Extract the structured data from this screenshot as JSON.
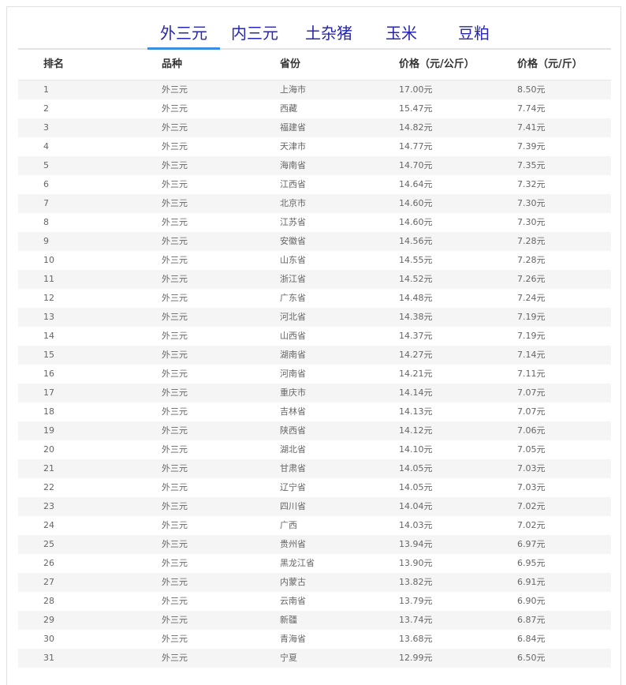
{
  "tabs": [
    {
      "label": "外三元",
      "active": true
    },
    {
      "label": "内三元",
      "active": false
    },
    {
      "label": "土杂猪",
      "active": false
    },
    {
      "label": "玉米",
      "active": false
    },
    {
      "label": "豆粕",
      "active": false
    }
  ],
  "table": {
    "headers": [
      "排名",
      "品种",
      "省份",
      "价格（元/公斤）",
      "价格（元/斤）"
    ],
    "rows": [
      [
        "1",
        "外三元",
        "上海市",
        "17.00元",
        "8.50元"
      ],
      [
        "2",
        "外三元",
        "西藏",
        "15.47元",
        "7.74元"
      ],
      [
        "3",
        "外三元",
        "福建省",
        "14.82元",
        "7.41元"
      ],
      [
        "4",
        "外三元",
        "天津市",
        "14.77元",
        "7.39元"
      ],
      [
        "5",
        "外三元",
        "海南省",
        "14.70元",
        "7.35元"
      ],
      [
        "6",
        "外三元",
        "江西省",
        "14.64元",
        "7.32元"
      ],
      [
        "7",
        "外三元",
        "北京市",
        "14.60元",
        "7.30元"
      ],
      [
        "8",
        "外三元",
        "江苏省",
        "14.60元",
        "7.30元"
      ],
      [
        "9",
        "外三元",
        "安徽省",
        "14.56元",
        "7.28元"
      ],
      [
        "10",
        "外三元",
        "山东省",
        "14.55元",
        "7.28元"
      ],
      [
        "11",
        "外三元",
        "浙江省",
        "14.52元",
        "7.26元"
      ],
      [
        "12",
        "外三元",
        "广东省",
        "14.48元",
        "7.24元"
      ],
      [
        "13",
        "外三元",
        "河北省",
        "14.38元",
        "7.19元"
      ],
      [
        "14",
        "外三元",
        "山西省",
        "14.37元",
        "7.19元"
      ],
      [
        "15",
        "外三元",
        "湖南省",
        "14.27元",
        "7.14元"
      ],
      [
        "16",
        "外三元",
        "河南省",
        "14.21元",
        "7.11元"
      ],
      [
        "17",
        "外三元",
        "重庆市",
        "14.14元",
        "7.07元"
      ],
      [
        "18",
        "外三元",
        "吉林省",
        "14.13元",
        "7.07元"
      ],
      [
        "19",
        "外三元",
        "陕西省",
        "14.12元",
        "7.06元"
      ],
      [
        "20",
        "外三元",
        "湖北省",
        "14.10元",
        "7.05元"
      ],
      [
        "21",
        "外三元",
        "甘肃省",
        "14.05元",
        "7.03元"
      ],
      [
        "22",
        "外三元",
        "辽宁省",
        "14.05元",
        "7.03元"
      ],
      [
        "23",
        "外三元",
        "四川省",
        "14.04元",
        "7.02元"
      ],
      [
        "24",
        "外三元",
        "广西",
        "14.03元",
        "7.02元"
      ],
      [
        "25",
        "外三元",
        "贵州省",
        "13.94元",
        "6.97元"
      ],
      [
        "26",
        "外三元",
        "黑龙江省",
        "13.90元",
        "6.95元"
      ],
      [
        "27",
        "外三元",
        "内蒙古",
        "13.82元",
        "6.91元"
      ],
      [
        "28",
        "外三元",
        "云南省",
        "13.79元",
        "6.90元"
      ],
      [
        "29",
        "外三元",
        "新疆",
        "13.74元",
        "6.87元"
      ],
      [
        "30",
        "外三元",
        "青海省",
        "13.68元",
        "6.84元"
      ],
      [
        "31",
        "外三元",
        "宁夏",
        "12.99元",
        "6.50元"
      ]
    ]
  },
  "colors": {
    "tab_text": "#2626b3",
    "tab_active_underline": "#3a8fe0",
    "row_stripe": "#f5f5f5"
  }
}
